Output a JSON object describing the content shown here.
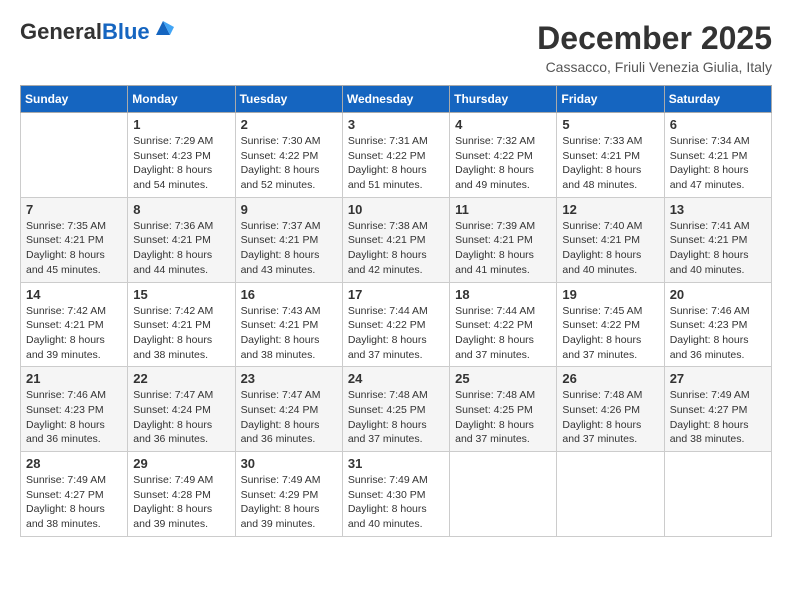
{
  "header": {
    "logo_line1": "General",
    "logo_line2": "Blue",
    "month_title": "December 2025",
    "location": "Cassacco, Friuli Venezia Giulia, Italy"
  },
  "weekdays": [
    "Sunday",
    "Monday",
    "Tuesday",
    "Wednesday",
    "Thursday",
    "Friday",
    "Saturday"
  ],
  "weeks": [
    [
      {
        "day": "",
        "sunrise": "",
        "sunset": "",
        "daylight": ""
      },
      {
        "day": "1",
        "sunrise": "Sunrise: 7:29 AM",
        "sunset": "Sunset: 4:23 PM",
        "daylight": "Daylight: 8 hours and 54 minutes."
      },
      {
        "day": "2",
        "sunrise": "Sunrise: 7:30 AM",
        "sunset": "Sunset: 4:22 PM",
        "daylight": "Daylight: 8 hours and 52 minutes."
      },
      {
        "day": "3",
        "sunrise": "Sunrise: 7:31 AM",
        "sunset": "Sunset: 4:22 PM",
        "daylight": "Daylight: 8 hours and 51 minutes."
      },
      {
        "day": "4",
        "sunrise": "Sunrise: 7:32 AM",
        "sunset": "Sunset: 4:22 PM",
        "daylight": "Daylight: 8 hours and 49 minutes."
      },
      {
        "day": "5",
        "sunrise": "Sunrise: 7:33 AM",
        "sunset": "Sunset: 4:21 PM",
        "daylight": "Daylight: 8 hours and 48 minutes."
      },
      {
        "day": "6",
        "sunrise": "Sunrise: 7:34 AM",
        "sunset": "Sunset: 4:21 PM",
        "daylight": "Daylight: 8 hours and 47 minutes."
      }
    ],
    [
      {
        "day": "7",
        "sunrise": "Sunrise: 7:35 AM",
        "sunset": "Sunset: 4:21 PM",
        "daylight": "Daylight: 8 hours and 45 minutes."
      },
      {
        "day": "8",
        "sunrise": "Sunrise: 7:36 AM",
        "sunset": "Sunset: 4:21 PM",
        "daylight": "Daylight: 8 hours and 44 minutes."
      },
      {
        "day": "9",
        "sunrise": "Sunrise: 7:37 AM",
        "sunset": "Sunset: 4:21 PM",
        "daylight": "Daylight: 8 hours and 43 minutes."
      },
      {
        "day": "10",
        "sunrise": "Sunrise: 7:38 AM",
        "sunset": "Sunset: 4:21 PM",
        "daylight": "Daylight: 8 hours and 42 minutes."
      },
      {
        "day": "11",
        "sunrise": "Sunrise: 7:39 AM",
        "sunset": "Sunset: 4:21 PM",
        "daylight": "Daylight: 8 hours and 41 minutes."
      },
      {
        "day": "12",
        "sunrise": "Sunrise: 7:40 AM",
        "sunset": "Sunset: 4:21 PM",
        "daylight": "Daylight: 8 hours and 40 minutes."
      },
      {
        "day": "13",
        "sunrise": "Sunrise: 7:41 AM",
        "sunset": "Sunset: 4:21 PM",
        "daylight": "Daylight: 8 hours and 40 minutes."
      }
    ],
    [
      {
        "day": "14",
        "sunrise": "Sunrise: 7:42 AM",
        "sunset": "Sunset: 4:21 PM",
        "daylight": "Daylight: 8 hours and 39 minutes."
      },
      {
        "day": "15",
        "sunrise": "Sunrise: 7:42 AM",
        "sunset": "Sunset: 4:21 PM",
        "daylight": "Daylight: 8 hours and 38 minutes."
      },
      {
        "day": "16",
        "sunrise": "Sunrise: 7:43 AM",
        "sunset": "Sunset: 4:21 PM",
        "daylight": "Daylight: 8 hours and 38 minutes."
      },
      {
        "day": "17",
        "sunrise": "Sunrise: 7:44 AM",
        "sunset": "Sunset: 4:22 PM",
        "daylight": "Daylight: 8 hours and 37 minutes."
      },
      {
        "day": "18",
        "sunrise": "Sunrise: 7:44 AM",
        "sunset": "Sunset: 4:22 PM",
        "daylight": "Daylight: 8 hours and 37 minutes."
      },
      {
        "day": "19",
        "sunrise": "Sunrise: 7:45 AM",
        "sunset": "Sunset: 4:22 PM",
        "daylight": "Daylight: 8 hours and 37 minutes."
      },
      {
        "day": "20",
        "sunrise": "Sunrise: 7:46 AM",
        "sunset": "Sunset: 4:23 PM",
        "daylight": "Daylight: 8 hours and 36 minutes."
      }
    ],
    [
      {
        "day": "21",
        "sunrise": "Sunrise: 7:46 AM",
        "sunset": "Sunset: 4:23 PM",
        "daylight": "Daylight: 8 hours and 36 minutes."
      },
      {
        "day": "22",
        "sunrise": "Sunrise: 7:47 AM",
        "sunset": "Sunset: 4:24 PM",
        "daylight": "Daylight: 8 hours and 36 minutes."
      },
      {
        "day": "23",
        "sunrise": "Sunrise: 7:47 AM",
        "sunset": "Sunset: 4:24 PM",
        "daylight": "Daylight: 8 hours and 36 minutes."
      },
      {
        "day": "24",
        "sunrise": "Sunrise: 7:48 AM",
        "sunset": "Sunset: 4:25 PM",
        "daylight": "Daylight: 8 hours and 37 minutes."
      },
      {
        "day": "25",
        "sunrise": "Sunrise: 7:48 AM",
        "sunset": "Sunset: 4:25 PM",
        "daylight": "Daylight: 8 hours and 37 minutes."
      },
      {
        "day": "26",
        "sunrise": "Sunrise: 7:48 AM",
        "sunset": "Sunset: 4:26 PM",
        "daylight": "Daylight: 8 hours and 37 minutes."
      },
      {
        "day": "27",
        "sunrise": "Sunrise: 7:49 AM",
        "sunset": "Sunset: 4:27 PM",
        "daylight": "Daylight: 8 hours and 38 minutes."
      }
    ],
    [
      {
        "day": "28",
        "sunrise": "Sunrise: 7:49 AM",
        "sunset": "Sunset: 4:27 PM",
        "daylight": "Daylight: 8 hours and 38 minutes."
      },
      {
        "day": "29",
        "sunrise": "Sunrise: 7:49 AM",
        "sunset": "Sunset: 4:28 PM",
        "daylight": "Daylight: 8 hours and 39 minutes."
      },
      {
        "day": "30",
        "sunrise": "Sunrise: 7:49 AM",
        "sunset": "Sunset: 4:29 PM",
        "daylight": "Daylight: 8 hours and 39 minutes."
      },
      {
        "day": "31",
        "sunrise": "Sunrise: 7:49 AM",
        "sunset": "Sunset: 4:30 PM",
        "daylight": "Daylight: 8 hours and 40 minutes."
      },
      {
        "day": "",
        "sunrise": "",
        "sunset": "",
        "daylight": ""
      },
      {
        "day": "",
        "sunrise": "",
        "sunset": "",
        "daylight": ""
      },
      {
        "day": "",
        "sunrise": "",
        "sunset": "",
        "daylight": ""
      }
    ]
  ]
}
